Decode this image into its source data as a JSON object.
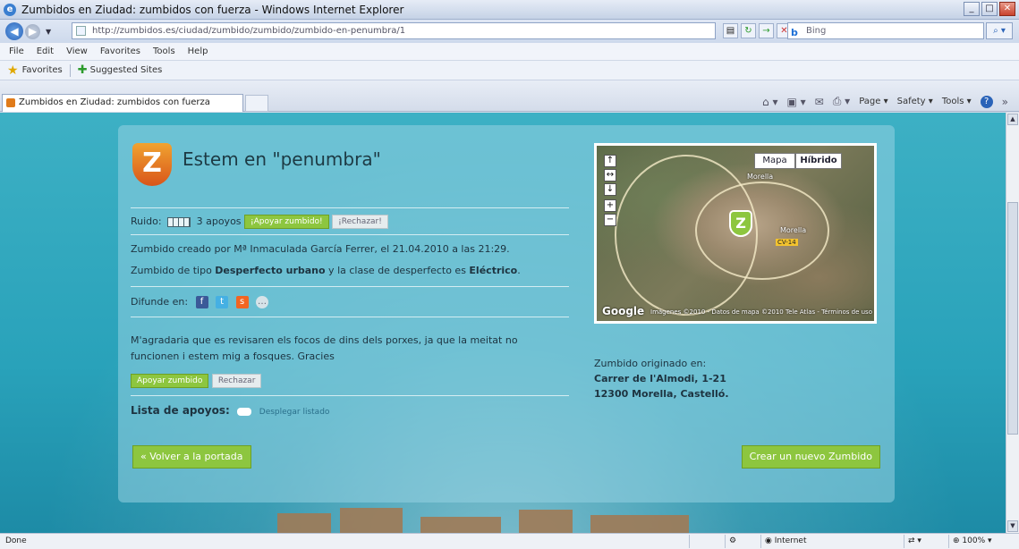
{
  "window": {
    "title": "Zumbidos en Ziudad: zumbidos con fuerza - Windows Internet Explorer",
    "minimize": "_",
    "maximize": "□",
    "close": "✕"
  },
  "address": {
    "url": "http://zumbidos.es/ciudad/zumbido/zumbido/zumbido-en-penumbra/1",
    "search_placeholder": "Bing",
    "search_engine": "b"
  },
  "menu": [
    "File",
    "Edit",
    "View",
    "Favorites",
    "Tools",
    "Help"
  ],
  "favorites": {
    "label": "Favorites",
    "suggested": "Suggested Sites"
  },
  "tab": {
    "title": "Zumbidos en Ziudad: zumbidos con fuerza"
  },
  "commandbar": {
    "page": "Page",
    "safety": "Safety",
    "tools": "Tools"
  },
  "zumbido": {
    "logo_letter": "Z",
    "title": "Estem en \"penumbra\"",
    "ruido_label": "Ruido:",
    "apoyos": "3 apoyos",
    "apoyar_btn": "¡Apoyar zumbido!",
    "rechazar_btn": "¡Rechazar!",
    "created_line": "Zumbido creado por Mª Inmaculada García Ferrer, el 21.04.2010 a las 21:29.",
    "type_prefix": "Zumbido de tipo ",
    "type_value": "Desperfecto urbano",
    "type_mid": " y la clase de desperfecto es ",
    "class_value": "Eléctrico",
    "type_suffix": ".",
    "difunde_label": "Difunde en:",
    "description": "M'agradaria que es revisaren els focos de dins dels porxes, ja que la meitat no funcionen i estem mig a fosques. Gracies",
    "apoyar_small": "Apoyar zumbido",
    "rechazar_small": "Rechazar",
    "lista_label": "Lista de apoyos:",
    "desplegar": "Desplegar listado",
    "volver": "« Volver a la portada",
    "crear": "Crear un nuevo Zumbido"
  },
  "map": {
    "mapa_btn": "Mapa",
    "hibrido_btn": "Híbrido",
    "labels": [
      "Morella",
      "Morella"
    ],
    "road_sign": "CV-14",
    "provider": "Google",
    "copyright": "Imágenes ©2010 - Datos de mapa ©2010 Tele Atlas - Términos de uso"
  },
  "address_info": {
    "heading": "Zumbido originado en:",
    "street": "Carrer de l'Almodi, 1-21",
    "city": "12300 Morella, Castelló."
  },
  "status": {
    "left": "Done",
    "zone": "Internet",
    "zoom": "100%"
  }
}
